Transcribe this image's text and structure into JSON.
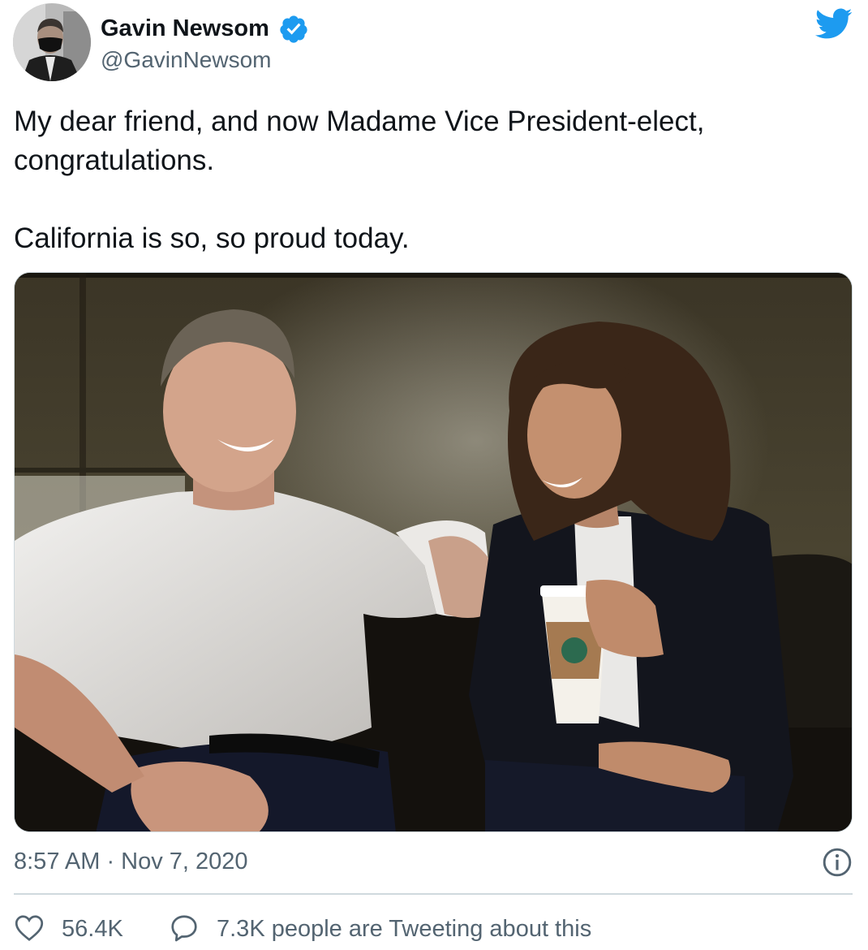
{
  "author": {
    "name": "Gavin Newsom",
    "handle": "@GavinNewsom",
    "verified": true
  },
  "tweet": {
    "paragraphs": [
      "My dear friend, and now Madame Vice President-elect,",
      "congratulations.",
      "California is so, so proud today."
    ]
  },
  "meta": {
    "timestamp": "8:57 AM · Nov 7, 2020"
  },
  "actions": {
    "likes": "56.4K",
    "tweeting_about": "7.3K people are Tweeting about this"
  },
  "colors": {
    "twitter_blue": "#1d9bf0",
    "text_primary": "#0f1419",
    "text_secondary": "#536471",
    "border": "#cfd9de"
  },
  "icons": {
    "logo": "twitter-bird-icon",
    "verified": "verified-badge-icon",
    "info": "info-icon",
    "like": "heart-icon",
    "reply": "speech-bubble-icon"
  }
}
